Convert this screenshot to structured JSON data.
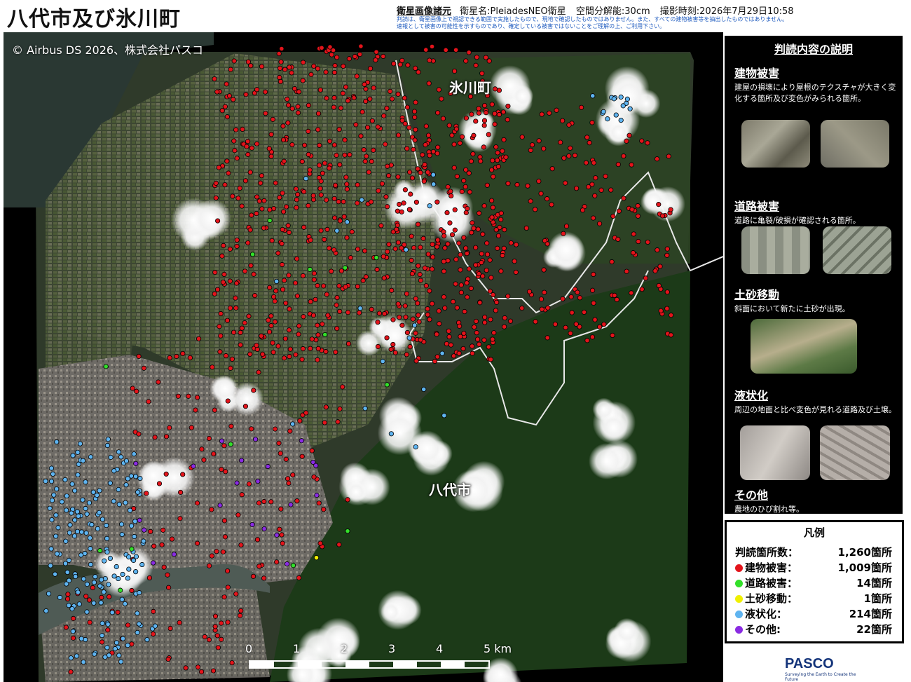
{
  "header": {
    "title": "八代市及び氷川町",
    "spec_label": "衛星画像諸元",
    "satellite": "衛星名:PleiadesNEO衛星",
    "resolution": "空間分解能:30cm",
    "capture_time": "撮影時刻:2026年7月29日10:58",
    "note_line1": "判読は、衛星画像上で視認できる範囲で実施したもので、現地で確認したものではありません。また、すべての建物被害等を抽出したものではありません。",
    "note_line2": "速報として被害の可能性を示すものであり、確定している被害ではないことをご理解の上、ご利用下さい。"
  },
  "map": {
    "copyright": "© Airbus DS 2026、株式会社パスコ",
    "place_labels": [
      {
        "key": "hikawa",
        "text": "氷川町"
      },
      {
        "key": "yatsushiro",
        "text": "八代市"
      }
    ],
    "scale_ticks": [
      "0",
      "1",
      "2",
      "3",
      "4",
      "5 km"
    ],
    "colors": {
      "building": "#e3141b",
      "road": "#33e02a",
      "landslide": "#f0f000",
      "liquefaction": "#5fb4f0",
      "other": "#8a2be2",
      "boundary": "#e8e8e8",
      "forest": "#1c3a18",
      "farmland": "#46503a",
      "urban": "#7a7770",
      "sea": "#2a3833",
      "river": "#4f5b55"
    }
  },
  "panel": {
    "title": "判読内容の説明",
    "categories": [
      {
        "title": "建物被害",
        "desc": "建屋の損壊により屋根のテクスチャが大きく変化する箇所及び変色がみられる箇所。"
      },
      {
        "title": "道路被害",
        "desc": "道路に亀裂/破損が確認される箇所。"
      },
      {
        "title": "土砂移動",
        "desc": "斜面において新たに土砂が出現。"
      },
      {
        "title": "液状化",
        "desc": "周辺の地面と比べ変色が見れる道路及び土壌。"
      },
      {
        "title": "その他",
        "desc": "農地のひび割れ等。"
      }
    ]
  },
  "legend": {
    "title": "凡例",
    "total_label": "判読箇所数：",
    "total_count": "1,260箇所",
    "items": [
      {
        "label": "建物被害：",
        "count": "1,009箇所",
        "color": "#e3141b"
      },
      {
        "label": "道路被害：",
        "count": "14箇所",
        "color": "#33e02a"
      },
      {
        "label": "土砂移動：",
        "count": "1箇所",
        "color": "#f0f000"
      },
      {
        "label": "液状化：",
        "count": "214箇所",
        "color": "#5fb4f0"
      },
      {
        "label": "その他:",
        "count": "22箇所",
        "color": "#8a2be2"
      }
    ]
  },
  "logo": {
    "brand": "PASCO",
    "tagline": "Surveying the Earth to Create the Future"
  }
}
